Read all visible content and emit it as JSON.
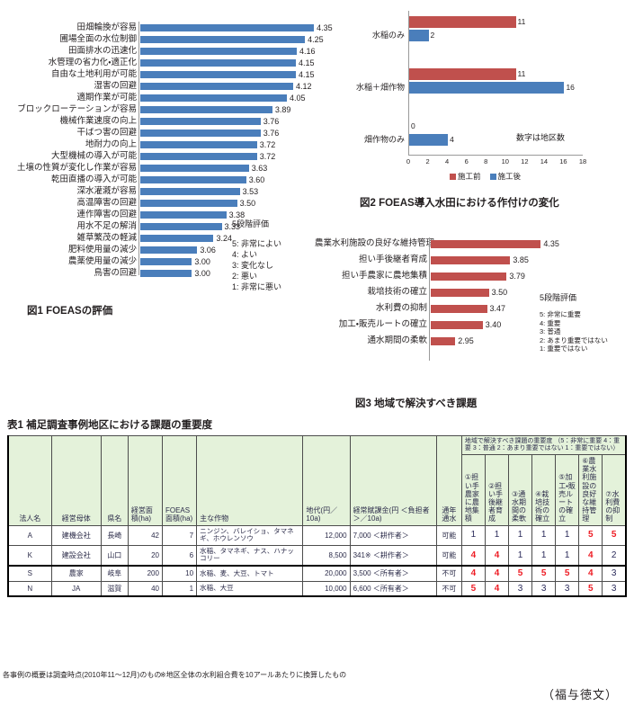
{
  "figure1": {
    "caption": "図1  FOEASの評価",
    "legend_title": "5段階評価",
    "legend_items": [
      "5: 非常によい",
      "4: よい",
      "3: 変化なし",
      "2: 悪い",
      "1: 非常に悪い"
    ],
    "bar_color": "#4a7ebb"
  },
  "figure2": {
    "caption": "図2  FOEAS導入水田における作付けの変化",
    "note": "数字は地区数",
    "legend": [
      {
        "label": "施工前",
        "color": "#c0504d"
      },
      {
        "label": "施工後",
        "color": "#4a7ebb"
      }
    ],
    "xticks": [
      "0",
      "2",
      "4",
      "6",
      "8",
      "10",
      "12",
      "14",
      "16",
      "18"
    ]
  },
  "figure3": {
    "caption": "図3  地域で解決すべき課題",
    "legend_title": "5段階評価",
    "legend_items": [
      "5: 非常に重要",
      "4: 重要",
      "3: 普通",
      "2: あまり重要ではない",
      "1: 重要ではない"
    ],
    "bar_color": "#c0504d"
  },
  "chart_data": [
    {
      "id": "fig1",
      "type": "bar",
      "orientation": "horizontal",
      "title": "図1  FOEASの評価",
      "xlabel": "",
      "ylabel": "",
      "xlim": [
        2.43,
        4.45
      ],
      "grid": false,
      "legend": "5段階評価 (5:非常によい / 4:よい / 3:変化なし / 2:悪い / 1:非常に悪い)",
      "categories": [
        "田畑輪換が容易",
        "圃場全面の水位制御",
        "田面排水の迅速化",
        "水管理の省力化・適正化",
        "自由な土地利用が可能",
        "湿害の回避",
        "適期作業が可能",
        "ブロックローテーションが容易",
        "機械作業速度の向上",
        "干ばつ害の回避",
        "地耐力の向上",
        "大型機械の導入が可能",
        "土壌の性質が変化し作業が容易",
        "乾田直播の導入が可能",
        "深水灌漑が容易",
        "高温障害の回避",
        "連作障害の回避",
        "用水不足の解消",
        "雑草繁茂の軽減",
        "肥料使用量の減少",
        "農薬使用量の減少",
        "鳥害の回避"
      ],
      "values": [
        4.35,
        4.25,
        4.16,
        4.15,
        4.15,
        4.12,
        4.05,
        3.89,
        3.76,
        3.76,
        3.72,
        3.72,
        3.63,
        3.6,
        3.53,
        3.5,
        3.38,
        3.33,
        3.24,
        3.06,
        3.0,
        3.0
      ]
    },
    {
      "id": "fig2",
      "type": "bar",
      "orientation": "horizontal",
      "title": "図2  FOEAS導入水田における作付けの変化",
      "xlabel": "",
      "ylabel": "",
      "xlim": [
        0,
        18
      ],
      "xticks": [
        0,
        2,
        4,
        6,
        8,
        10,
        12,
        14,
        16,
        18
      ],
      "grid": false,
      "legend_position": "bottom",
      "annotation": "数字は地区数",
      "categories": [
        "水稲のみ",
        "水稲＋畑作物",
        "畑作物のみ"
      ],
      "series": [
        {
          "name": "施工前",
          "color": "#c0504d",
          "values": [
            11,
            11,
            0
          ]
        },
        {
          "name": "施工後",
          "color": "#4a7ebb",
          "values": [
            2,
            16,
            4
          ]
        }
      ]
    },
    {
      "id": "fig3",
      "type": "bar",
      "orientation": "horizontal",
      "title": "図3  地域で解決すべき課題",
      "xlabel": "",
      "ylabel": "",
      "xlim": [
        2.55,
        4.45
      ],
      "grid": false,
      "legend": "5段階評価 (5:非常に重要 / 4:重要 / 3:普通 / 2:あまり重要ではない / 1:重要ではない)",
      "categories": [
        "農業水利施設の良好な維持管理",
        "担い手後継者育成",
        "担い手農家に農地集積",
        "栽培技術の確立",
        "水利費の抑制",
        "加工・販売ルートの確立",
        "通水期間の柔軟"
      ],
      "values": [
        4.35,
        3.85,
        3.79,
        3.5,
        3.47,
        3.4,
        2.95
      ]
    }
  ],
  "table": {
    "title": "表1  補足調査事例地区における課題の重要度",
    "group_header": "地域で解決すべき課題の重要度 （5：非常に重要  4：重要  3：普通  2：あまり重要ではない  1：重要ではない）",
    "columns": [
      "法人名",
      "経営母体",
      "県名",
      "経営面積(ha)",
      "FOEAS面積(ha)",
      "主な作物",
      "地代(円／10a)",
      "経常賦課金(円  ＜負担者＞／10a)",
      "通年通水",
      "①担い手農家に農地集積",
      "②担い手後継者育成",
      "③通水期間の柔軟",
      "④栽培技術の確立",
      "⑤加工・販売ルートの確立",
      "⑥農業水利施設の良好な維持管理",
      "⑦水利費の抑制"
    ],
    "rows": [
      {
        "name": "A",
        "body": "建機会社",
        "pref": "長崎",
        "area": "42",
        "foeas": "7",
        "crops": "ニンジン、バレイショ、タマネギ、ホウレンソウ",
        "rent": "12,000",
        "levy": "7,000  ＜耕作者＞",
        "water": "可能",
        "scores": [
          "1",
          "1",
          "1",
          "1",
          "1",
          "5",
          "5"
        ],
        "highlight": [
          false,
          false,
          false,
          false,
          false,
          true,
          true
        ]
      },
      {
        "name": "K",
        "body": "建設会社",
        "pref": "山口",
        "area": "20",
        "foeas": "6",
        "crops": "水稲、タマネギ、ナス、ハナッコリー",
        "rent": "8,500",
        "levy": "341※  ＜耕作者＞",
        "water": "可能",
        "scores": [
          "4",
          "4",
          "1",
          "1",
          "1",
          "4",
          "2"
        ],
        "highlight": [
          true,
          true,
          false,
          false,
          false,
          true,
          false
        ]
      },
      {
        "name": "S",
        "body": "農家",
        "pref": "岐阜",
        "area": "200",
        "foeas": "10",
        "crops": "水稲、麦、大豆、トマト",
        "rent": "20,000",
        "levy": "3,500  ＜所有者＞",
        "water": "不可",
        "scores": [
          "4",
          "4",
          "5",
          "5",
          "5",
          "4",
          "3"
        ],
        "highlight": [
          true,
          true,
          true,
          true,
          true,
          true,
          false
        ]
      },
      {
        "name": "N",
        "body": "JA",
        "pref": "滋賀",
        "area": "40",
        "foeas": "1",
        "crops": "水稲、大豆",
        "rent": "10,000",
        "levy": "6,600  ＜所有者＞",
        "water": "不可",
        "scores": [
          "5",
          "4",
          "3",
          "3",
          "3",
          "5",
          "3"
        ],
        "highlight": [
          true,
          true,
          false,
          false,
          false,
          true,
          false
        ]
      }
    ]
  },
  "footnotes": {
    "left": "各事例の概要は調査時点(2010年11～12月)のもの",
    "right": "※地区全体の水利組合費を10アールあたりに換算したもの"
  },
  "author": "（福与徳文）"
}
